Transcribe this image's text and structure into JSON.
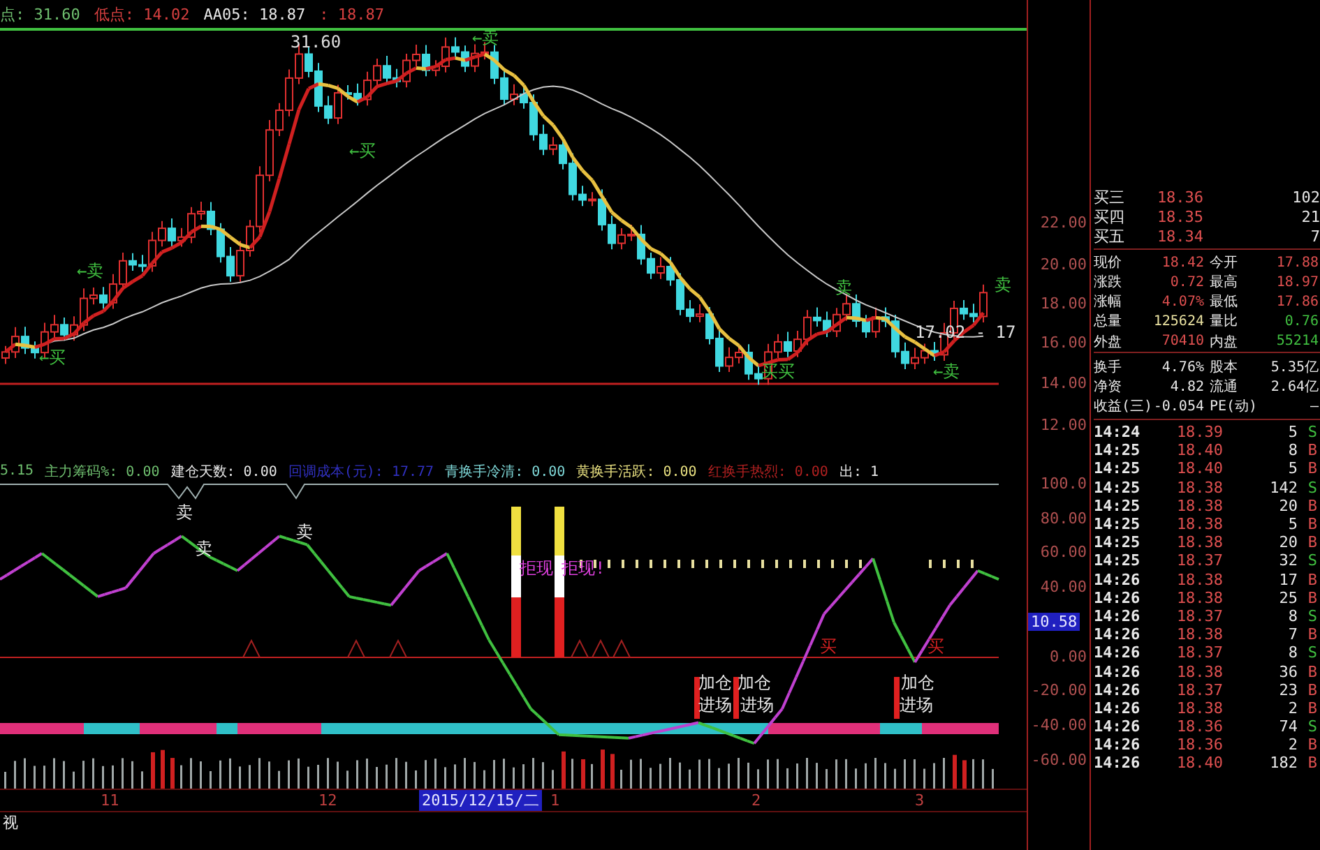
{
  "price_header": [
    {
      "text": "点: 31.60",
      "color": "#6fbf6f"
    },
    {
      "text": "低点: 14.02",
      "color": "#d84040"
    },
    {
      "text": "AA05: 18.87",
      "color": "#e8e8e8"
    },
    {
      "text": ": 18.87",
      "color": "#d84040"
    }
  ],
  "price_annotations": [
    "31.60",
    "←卖",
    "←买",
    "←卖",
    "←买",
    "买买",
    "卖",
    "卖",
    "←卖",
    "17.02 - 17"
  ],
  "price_axis": [
    "22.00",
    "20.00",
    "18.00",
    "16.00",
    "14.00",
    "12.00"
  ],
  "indicator_header": [
    {
      "text": "5.15",
      "color": "#6fbf6f"
    },
    {
      "text": "主力筹码%: 0.00",
      "color": "#6fbf6f"
    },
    {
      "text": "建仓天数: 0.00",
      "color": "#e8e8e8"
    },
    {
      "text": "回调成本(元): 17.77",
      "color": "#3030c0"
    },
    {
      "text": "青换手冷清: 0.00",
      "color": "#7fd8d8"
    },
    {
      "text": "黄换手活跃: 0.00",
      "color": "#e8e080"
    },
    {
      "text": "红换手热烈: 0.00",
      "color": "#b02020"
    },
    {
      "text": "出: 1",
      "color": "#e8e8e8"
    }
  ],
  "indicator_annotations": [
    "卖",
    "卖",
    "卖",
    "拒现",
    "拒现!",
    "加仓",
    "加仓",
    "进场",
    "进场",
    "加仓",
    "进场",
    "买",
    "买"
  ],
  "indicator_axis": [
    "100.0",
    "80.00",
    "60.00",
    "40.00",
    "0.00",
    "-20.00",
    "-40.00",
    "-60.00"
  ],
  "cursor_value": "10.58",
  "date_axis": [
    "11",
    "12",
    "1",
    "2",
    "3"
  ],
  "cursor_date": "2015/12/15/二",
  "bottom_tab": "视",
  "order_book": [
    {
      "label": "买三",
      "price": "18.36",
      "volume": "102"
    },
    {
      "label": "买四",
      "price": "18.35",
      "volume": "21"
    },
    {
      "label": "买五",
      "price": "18.34",
      "volume": "7"
    }
  ],
  "quote_stats": [
    {
      "label": "现价",
      "value": "18.42",
      "color": "#e05050"
    },
    {
      "label": "今开",
      "value": "17.88",
      "color": "#e05050"
    },
    {
      "label": "涨跌",
      "value": "0.72",
      "color": "#e05050"
    },
    {
      "label": "最高",
      "value": "18.97",
      "color": "#e05050"
    },
    {
      "label": "涨幅",
      "value": "4.07%",
      "color": "#e05050"
    },
    {
      "label": "最低",
      "value": "17.86",
      "color": "#e05050"
    },
    {
      "label": "总量",
      "value": "125624",
      "color": "#e8e0a0"
    },
    {
      "label": "量比",
      "value": "0.76",
      "color": "#40c040"
    },
    {
      "label": "外盘",
      "value": "70410",
      "color": "#e05050"
    },
    {
      "label": "内盘",
      "value": "55214",
      "color": "#40c040"
    },
    {
      "label": "换手",
      "value": "4.76%",
      "color": "#e8e8e8"
    },
    {
      "label": "股本",
      "value": "5.35亿",
      "color": "#e8e8e8"
    },
    {
      "label": "净资",
      "value": "4.82",
      "color": "#e8e8e8"
    },
    {
      "label": "流通",
      "value": "2.64亿",
      "color": "#e8e8e8"
    },
    {
      "label": "收益(三)",
      "value": "-0.054",
      "color": "#e8e8e8"
    },
    {
      "label": "PE(动)",
      "value": "—",
      "color": "#e8e8e8"
    }
  ],
  "ticks": [
    {
      "time": "14:24",
      "price": "18.39",
      "volume": "5",
      "side": "S",
      "color": "#40c040"
    },
    {
      "time": "14:25",
      "price": "18.40",
      "volume": "8",
      "side": "B",
      "color": "#e05050"
    },
    {
      "time": "14:25",
      "price": "18.40",
      "volume": "5",
      "side": "B",
      "color": "#e05050"
    },
    {
      "time": "14:25",
      "price": "18.38",
      "volume": "142",
      "side": "S",
      "color": "#40c040"
    },
    {
      "time": "14:25",
      "price": "18.38",
      "volume": "20",
      "side": "B",
      "color": "#e05050"
    },
    {
      "time": "14:25",
      "price": "18.38",
      "volume": "5",
      "side": "B",
      "color": "#e05050"
    },
    {
      "time": "14:25",
      "price": "18.38",
      "volume": "20",
      "side": "B",
      "color": "#e05050"
    },
    {
      "time": "14:25",
      "price": "18.37",
      "volume": "32",
      "side": "S",
      "color": "#40c040"
    },
    {
      "time": "14:26",
      "price": "18.38",
      "volume": "17",
      "side": "B",
      "color": "#e05050"
    },
    {
      "time": "14:26",
      "price": "18.38",
      "volume": "25",
      "side": "B",
      "color": "#e05050"
    },
    {
      "time": "14:26",
      "price": "18.37",
      "volume": "8",
      "side": "S",
      "color": "#40c040"
    },
    {
      "time": "14:26",
      "price": "18.38",
      "volume": "7",
      "side": "B",
      "color": "#e05050"
    },
    {
      "time": "14:26",
      "price": "18.37",
      "volume": "8",
      "side": "S",
      "color": "#40c040"
    },
    {
      "time": "14:26",
      "price": "18.38",
      "volume": "36",
      "side": "B",
      "color": "#e05050"
    },
    {
      "time": "14:26",
      "price": "18.37",
      "volume": "23",
      "side": "B",
      "color": "#e05050"
    },
    {
      "time": "14:26",
      "price": "18.38",
      "volume": "2",
      "side": "B",
      "color": "#e05050"
    },
    {
      "time": "14:26",
      "price": "18.36",
      "volume": "74",
      "side": "S",
      "color": "#40c040"
    },
    {
      "time": "14:26",
      "price": "18.36",
      "volume": "2",
      "side": "B",
      "color": "#e05050"
    },
    {
      "time": "14:26",
      "price": "18.40",
      "volume": "182",
      "side": "B",
      "color": "#e05050"
    }
  ]
}
